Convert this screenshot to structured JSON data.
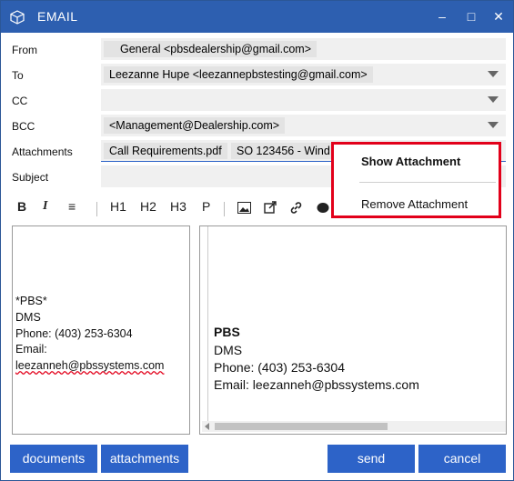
{
  "window": {
    "title": "EMAIL",
    "minimize": "–",
    "maximize": "□",
    "close": "✕",
    "app_icon": "cube-icon",
    "accent": "#2d5fb0"
  },
  "fields": {
    "from_label": "From",
    "from_value": "General  <pbsdealership@gmail.com>",
    "to_label": "To",
    "to_value": "Leezanne Hupe <leezannepbstesting@gmail.com>",
    "cc_label": "CC",
    "cc_value": "",
    "bcc_label": "BCC",
    "bcc_value": "<Management@Dealership.com>",
    "attachments_label": "Attachments",
    "attachment_1": "Call Requirements.pdf",
    "attachment_2": "SO 123456 - Wind",
    "subject_label": "Subject",
    "subject_value": ""
  },
  "toolbar": {
    "bold": "B",
    "italic": "I",
    "align": "≡",
    "h1": "H1",
    "h2": "H2",
    "h3": "H3",
    "p": "P",
    "image": "image-icon",
    "link_out": "external-link-icon",
    "link": "link-icon",
    "color": "color-icon"
  },
  "editor_source": {
    "line1": "*PBS*",
    "line2": "DMS",
    "line3": "Phone: (403) 253-6304",
    "line4": "Email:",
    "line5": "leezanneh@pbssystems.com"
  },
  "editor_preview": {
    "line1": "PBS",
    "line2": "DMS",
    "line3": "Phone: (403) 253-6304",
    "line4": "Email: leezanneh@pbssystems.com"
  },
  "buttons": {
    "documents": "documents",
    "attachments": "attachments",
    "send": "send",
    "cancel": "cancel"
  },
  "context_menu": {
    "show": "Show Attachment",
    "remove": "Remove Attachment",
    "highlight_color": "#e2001a"
  }
}
